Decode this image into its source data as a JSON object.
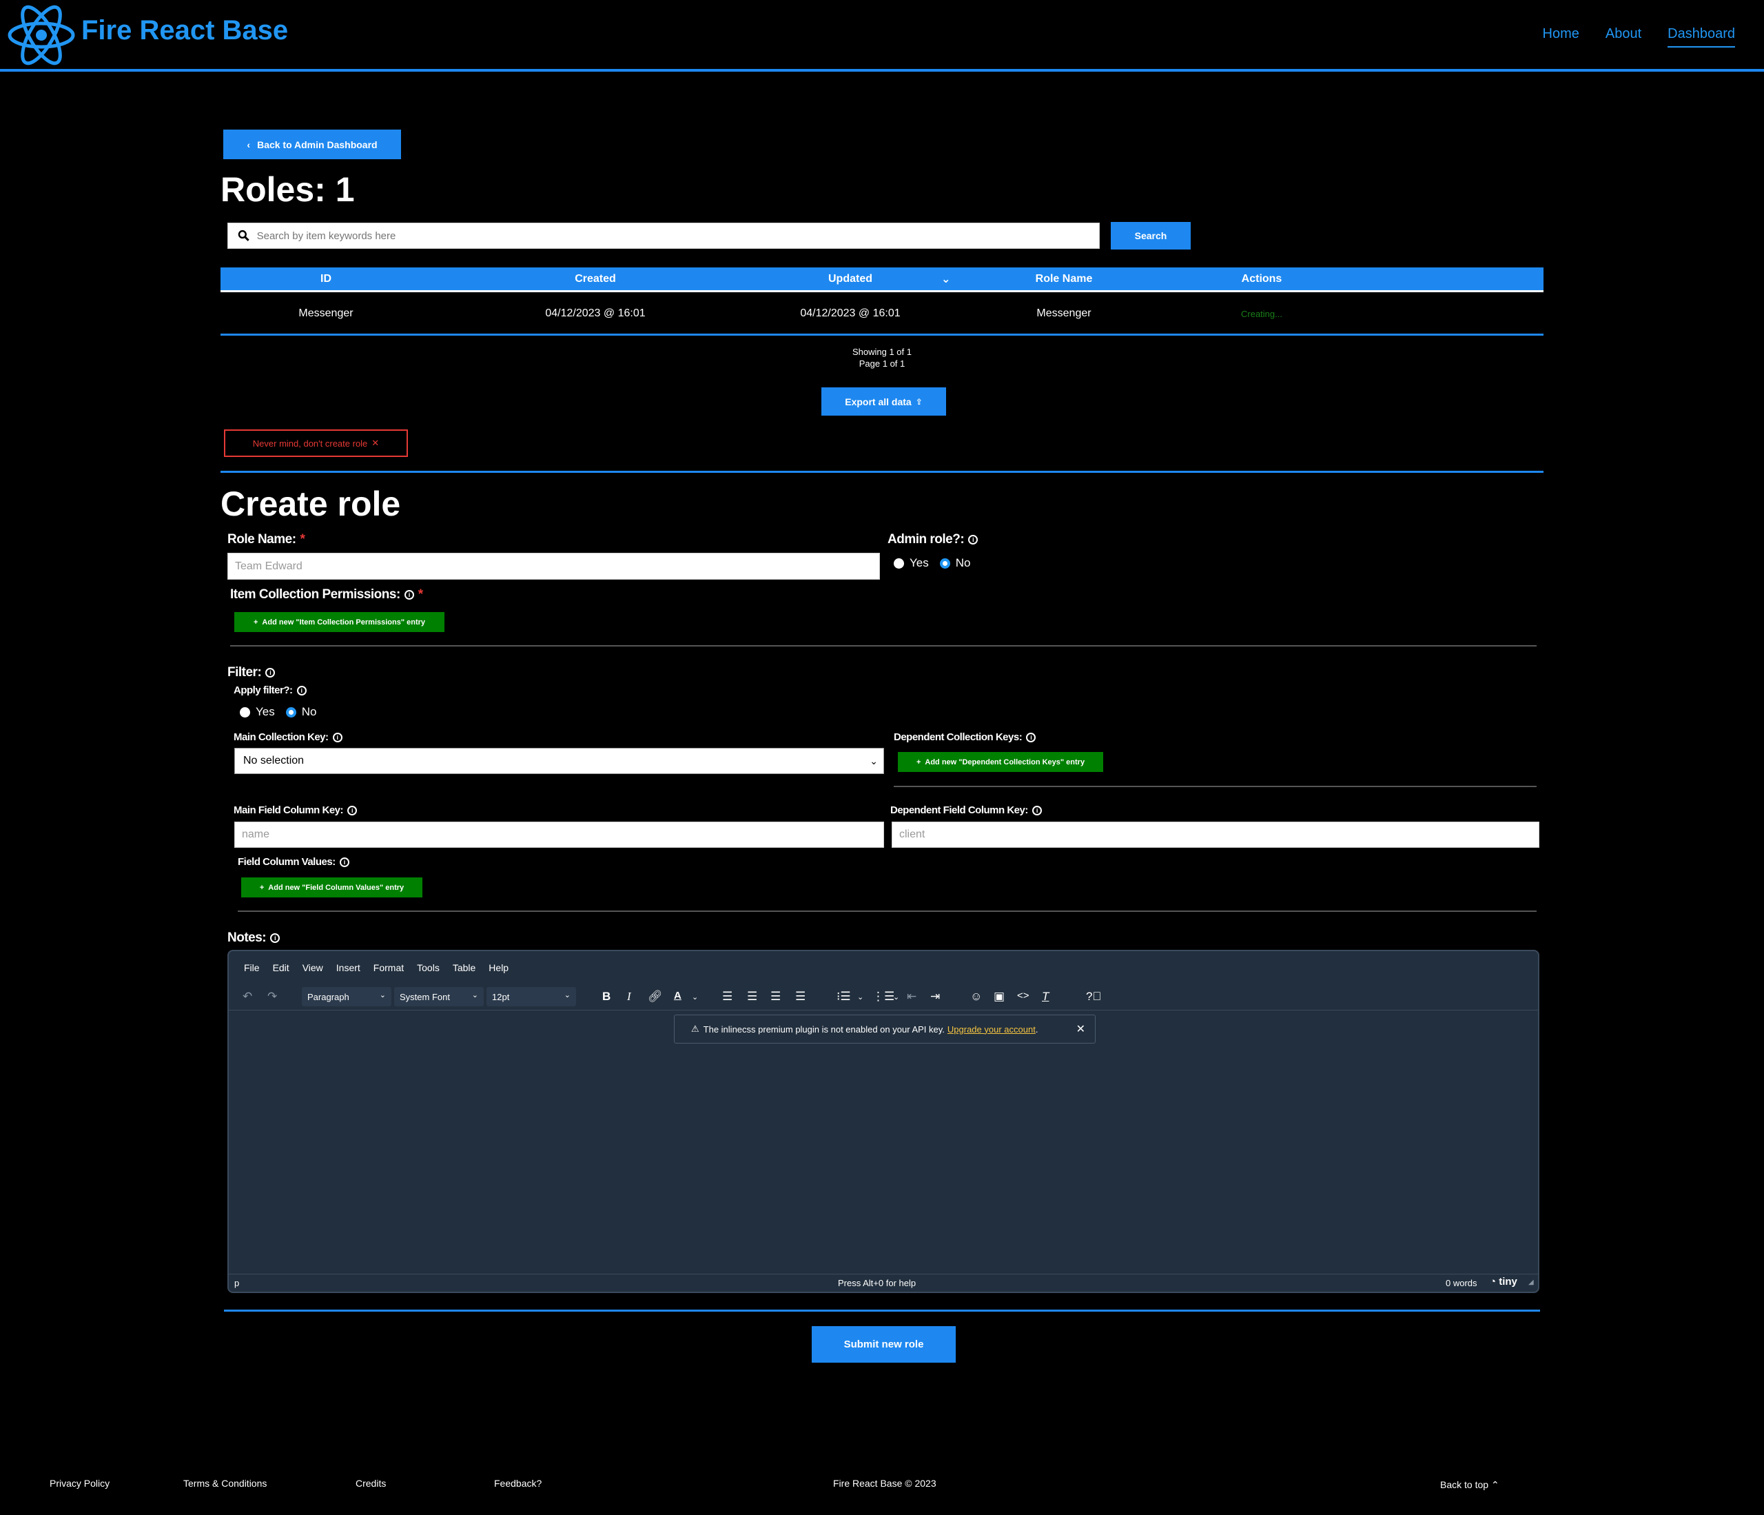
{
  "header": {
    "brand": "Fire React Base",
    "nav": [
      "Home",
      "About",
      "Dashboard"
    ]
  },
  "back_button": "Back to Admin Dashboard",
  "page_title": "Roles: 1",
  "search": {
    "placeholder": "Search by item keywords here",
    "button": "Search"
  },
  "table": {
    "headers": [
      "ID",
      "Created",
      "Updated",
      "Role Name",
      "Actions"
    ],
    "sort_indicator": "⌄",
    "rows": [
      {
        "id": "Messenger",
        "created": "04/12/2023 @ 16:01",
        "updated": "04/12/2023 @ 16:01",
        "role_name": "Messenger",
        "actions": "Creating..."
      }
    ]
  },
  "pagination": {
    "showing": "Showing 1 of 1",
    "page": "Page 1 of 1"
  },
  "export_button": "Export all data",
  "cancel_button": "Never mind, don't create role",
  "create": {
    "title": "Create role",
    "role_name_label": "Role Name:",
    "role_name_placeholder": "Team Edward",
    "admin_label": "Admin role?:",
    "admin_options": [
      "Yes",
      "No"
    ],
    "admin_selected": "No",
    "item_perm_label": "Item Collection Permissions:",
    "item_perm_button": "Add new \"Item Collection Permissions\" entry",
    "filter_label": "Filter:",
    "apply_filter_label": "Apply filter?:",
    "apply_filter_options": [
      "Yes",
      "No"
    ],
    "apply_filter_selected": "No",
    "main_collection_label": "Main Collection Key:",
    "main_collection_value": "No selection",
    "dependent_keys_label": "Dependent Collection Keys:",
    "dependent_keys_button": "Add new \"Dependent Collection Keys\" entry",
    "main_field_label": "Main Field Column Key:",
    "main_field_placeholder": "name",
    "dependent_field_label": "Dependent Field Column Key:",
    "dependent_field_placeholder": "client",
    "field_values_label": "Field Column Values:",
    "field_values_button": "Add new \"Field Column Values\" entry",
    "notes_label": "Notes:",
    "submit_button": "Submit new role"
  },
  "editor": {
    "menu": [
      "File",
      "Edit",
      "View",
      "Insert",
      "Format",
      "Tools",
      "Table",
      "Help"
    ],
    "block_format": "Paragraph",
    "font_family": "System Font",
    "font_size": "12pt",
    "notification": "The inlinecss premium plugin is not enabled on your API key.",
    "notification_link": "Upgrade your account",
    "status_path": "p",
    "status_help": "Press Alt+0 for help",
    "word_count": "0 words",
    "brand": "tiny"
  },
  "footer": {
    "links": [
      "Privacy Policy",
      "Terms & Conditions",
      "Credits",
      "Feedback?"
    ],
    "copyright": "Fire React Base © 2023",
    "back_to_top": "Back to top"
  },
  "colors": {
    "accent": "#1e88f0",
    "success": "#008000",
    "danger": "#e53935",
    "editor_bg": "#222f3e"
  }
}
